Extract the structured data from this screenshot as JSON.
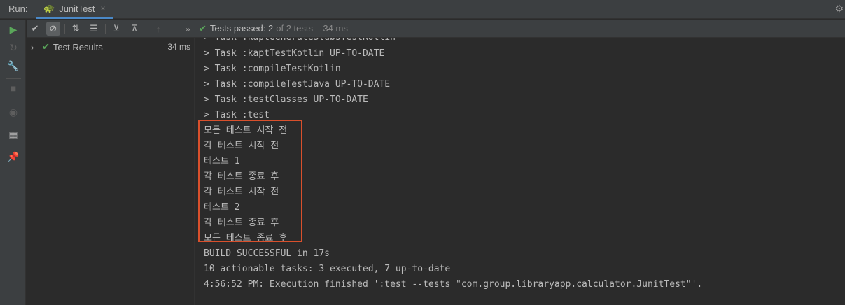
{
  "header": {
    "run_label": "Run:",
    "tab_icon": "turtle-icon",
    "tab_name": "JunitTest",
    "close_icon": "×",
    "settings_icon": "gear-icon"
  },
  "status": {
    "passed_text": "Tests passed: 2",
    "detail_text": "of 2 tests – 34 ms"
  },
  "tree": {
    "root_label": "Test Results",
    "root_time": "34 ms"
  },
  "console": {
    "lines": [
      "> Task :kaptGenerateStubsTestKotlin",
      "> Task :kaptTestKotlin UP-TO-DATE",
      "> Task :compileTestKotlin",
      "> Task :compileTestJava UP-TO-DATE",
      "> Task :testClasses UP-TO-DATE",
      "> Task :test",
      "모든 테스트 시작 전",
      "각 테스트 시작 전",
      "테스트 1",
      "각 테스트 종료 후",
      "각 테스트 시작 전",
      "테스트 2",
      "각 테스트 종료 후",
      "모든 테스트 종료 후",
      "",
      "BUILD SUCCESSFUL in 17s",
      "10 actionable tasks: 3 executed, 7 up-to-date",
      "4:56:52 PM: Execution finished ':test --tests \"com.group.libraryapp.calculator.JunitTest\"'."
    ]
  },
  "colors": {
    "pass_green": "#5aa65a",
    "highlight_red": "#d9502c",
    "tab_underline": "#4a88c7"
  }
}
